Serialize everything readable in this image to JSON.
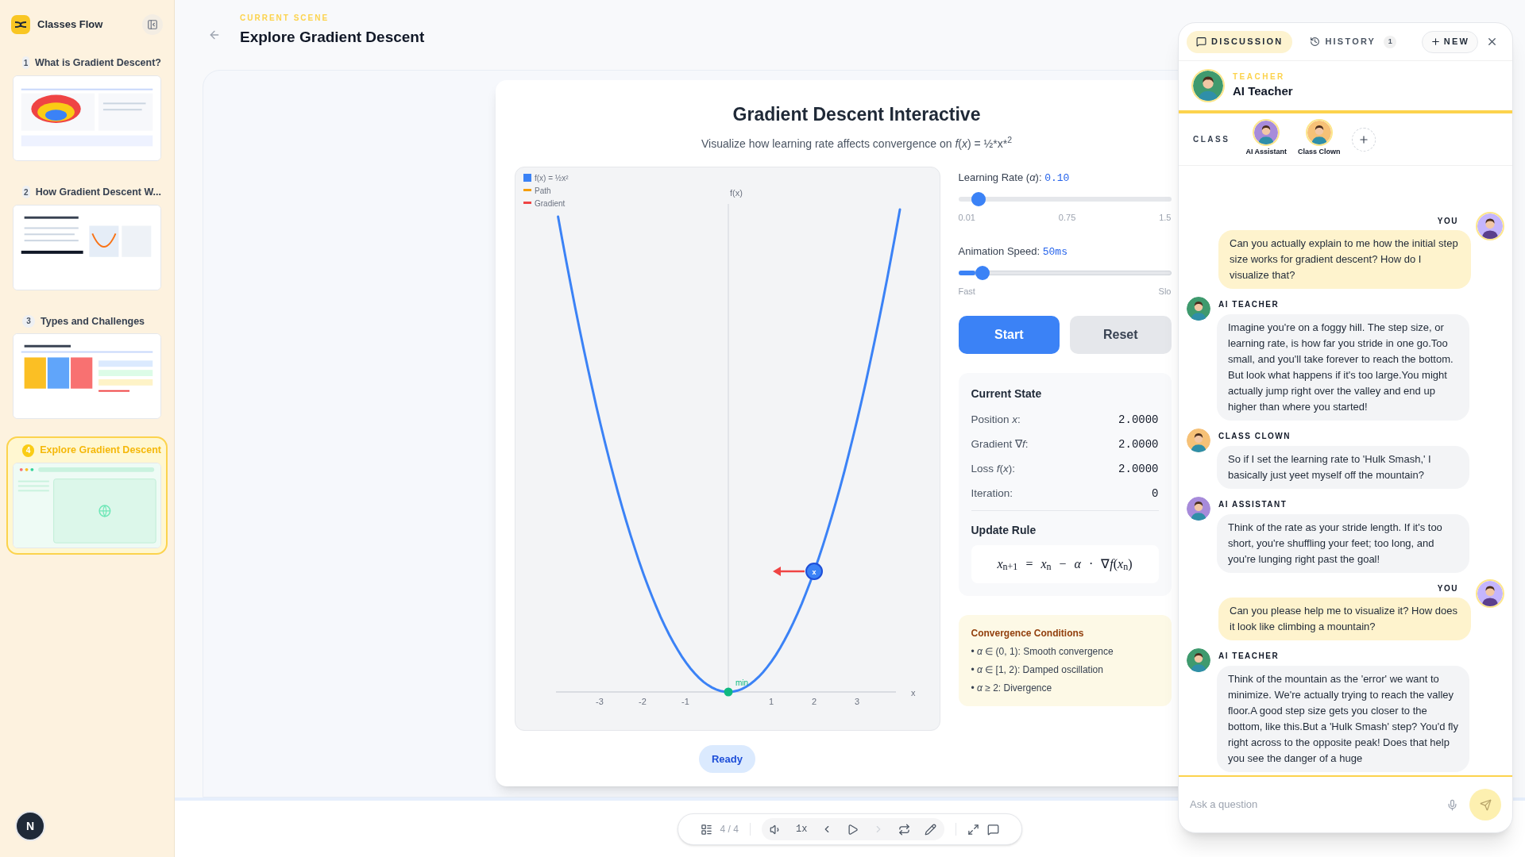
{
  "sidebar": {
    "app_name": "Classes Flow",
    "scenes": [
      {
        "number": "1",
        "title": "What is Gradient Descent?",
        "selected": false,
        "kind": "bowl"
      },
      {
        "number": "2",
        "title": "How Gradient Descent W...",
        "selected": false,
        "kind": "formula"
      },
      {
        "number": "3",
        "title": "Types and Challenges",
        "selected": false,
        "kind": "panels"
      },
      {
        "number": "4",
        "title": "Explore Gradient Descent",
        "selected": true,
        "kind": "web"
      }
    ],
    "user_initial": "N"
  },
  "header": {
    "eyebrow": "CURRENT SCENE",
    "title": "Explore Gradient Descent"
  },
  "widget": {
    "title": "Gradient Descent Interactive",
    "subtitle": "Visualize how learning rate affects convergence on *f*(*x*) = ½*x*$^{2}$",
    "plot": {
      "legend": [
        {
          "label": "f(x) = ½x²",
          "kind": "square",
          "color": "#3b82f6"
        },
        {
          "label": "Path",
          "kind": "line",
          "color": "#f59e0b"
        },
        {
          "label": "Gradient",
          "kind": "line",
          "color": "#ef4444"
        }
      ],
      "y_axis_label": "f(x)",
      "x_axis_label": "x",
      "ticks": [
        "-3",
        "-2",
        "-1",
        "1",
        "2",
        "3"
      ],
      "min_label": "min",
      "marker_label": "x"
    },
    "status": "Ready",
    "sliders": [
      {
        "label": "Learning Rate (*α*):",
        "reading": "0.10",
        "level": 0.06,
        "kind": "plain",
        "ticks": [
          "0.01",
          "0.75",
          "1.5"
        ]
      },
      {
        "label": "Animation Speed:",
        "reading": "50ms",
        "level": 0.08,
        "kind": "filled",
        "ticks": [
          "Fast",
          "Slo"
        ]
      }
    ],
    "buttons": [
      {
        "label": "Start",
        "kind": "primary"
      },
      {
        "label": "Reset",
        "kind": "secondary"
      }
    ],
    "state": {
      "title": "Current State",
      "rows": [
        {
          "label": "Position *x*:",
          "value": "2.0000"
        },
        {
          "label": "Gradient ∇*f*:",
          "value": "2.0000"
        },
        {
          "label": "Loss *f*(*x*):",
          "value": "2.0000"
        },
        {
          "label": "Iteration:",
          "value": "0"
        }
      ],
      "rule_title": "Update Rule",
      "rule": "*x*$_{n+1}$ = *x*$_{n}$ − *α* · ∇*f*(*x*$_{n}$)"
    },
    "conditions": {
      "title": "Convergence Conditions",
      "items": [
        "• *α* ∈ (0, 1): Smooth convergence",
        "• *α* ∈ [1, 2): Damped oscillation",
        "• *α* ≥ 2: Divergence"
      ]
    }
  },
  "toolbar": {
    "page_counter": "4 / 4",
    "speed": "1x"
  },
  "chat": {
    "tabs": [
      {
        "label": "DISCUSSION",
        "selected": true,
        "kind": "discussion"
      },
      {
        "label": "HISTORY",
        "selected": false,
        "kind": "history",
        "badge": "1"
      }
    ],
    "new_label": "NEW",
    "teacher": {
      "role": "TEACHER",
      "name": "AI Teacher"
    },
    "class_label": "CLASS",
    "classmates": [
      {
        "name": "AI Assistant",
        "color": "#a78bda"
      },
      {
        "name": "Class Clown",
        "color": "#f6c177"
      }
    ],
    "messages": [
      {
        "sender": "YOU",
        "kind": "user",
        "color": "#c4b5fd",
        "text": "Can you actually explain to me how the initial step size works for gradient descent? How do I visualize that?"
      },
      {
        "sender": "AI TEACHER",
        "kind": "agent",
        "color": "#3f9a6e",
        "text": "Imagine you're on a foggy hill. The step size, or learning rate, is how far you stride in one go.Too small, and you'll take forever to reach the bottom. But look what happens if it's too large.You might actually jump right over the valley and end up higher than where you started!"
      },
      {
        "sender": "CLASS CLOWN",
        "kind": "agent",
        "color": "#f6c177",
        "text": "So if I set the learning rate to 'Hulk Smash,' I basically just yeet myself off the mountain?"
      },
      {
        "sender": "AI ASSISTANT",
        "kind": "agent",
        "color": "#a78bda",
        "text": "Think of the rate as your stride length. If it's too short, you're shuffling your feet; too long, and you're lunging right past the goal!"
      },
      {
        "sender": "YOU",
        "kind": "user",
        "color": "#c4b5fd",
        "text": "Can you please help me to visualize it? How does it look like climbing a mountain?"
      },
      {
        "sender": "AI TEACHER",
        "kind": "agent",
        "color": "#3f9a6e",
        "text": "Think of the mountain as the 'error' we want to minimize. We're actually trying to reach the valley floor.A good step size gets you closer to the bottom, like this.But a 'Hulk Smash' step? You'd fly right across to the opposite peak! Does that help you see the danger of a huge"
      }
    ],
    "input": {
      "placeholder": "Ask a question"
    }
  }
}
